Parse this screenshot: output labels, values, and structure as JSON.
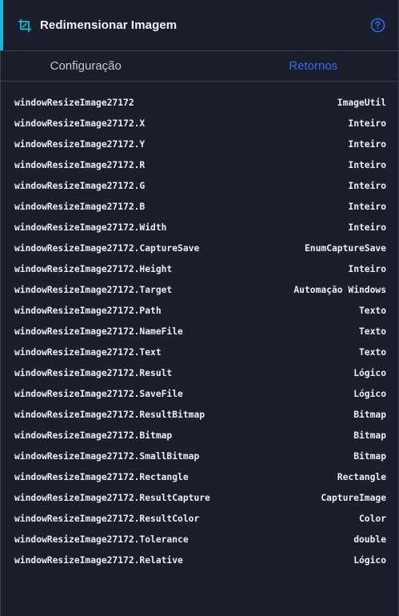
{
  "header": {
    "title": "Redimensionar Imagem",
    "icon": "resize-icon",
    "help_icon": "help-circle-icon",
    "accent_color": "#1ab6d6"
  },
  "tabs": [
    {
      "label": "Configuração",
      "active": false
    },
    {
      "label": "Retornos",
      "active": true,
      "color": "#2f6bf0"
    }
  ],
  "returns": [
    {
      "name": "windowResizeImage27172",
      "type": "ImageUtil"
    },
    {
      "name": "windowResizeImage27172.X",
      "type": "Inteiro"
    },
    {
      "name": "windowResizeImage27172.Y",
      "type": "Inteiro"
    },
    {
      "name": "windowResizeImage27172.R",
      "type": "Inteiro"
    },
    {
      "name": "windowResizeImage27172.G",
      "type": "Inteiro"
    },
    {
      "name": "windowResizeImage27172.B",
      "type": "Inteiro"
    },
    {
      "name": "windowResizeImage27172.Width",
      "type": "Inteiro"
    },
    {
      "name": "windowResizeImage27172.CaptureSave",
      "type": "EnumCaptureSave"
    },
    {
      "name": "windowResizeImage27172.Height",
      "type": "Inteiro"
    },
    {
      "name": "windowResizeImage27172.Target",
      "type": "Automação Windows"
    },
    {
      "name": "windowResizeImage27172.Path",
      "type": "Texto"
    },
    {
      "name": "windowResizeImage27172.NameFile",
      "type": "Texto"
    },
    {
      "name": "windowResizeImage27172.Text",
      "type": "Texto"
    },
    {
      "name": "windowResizeImage27172.Result",
      "type": "Lógico"
    },
    {
      "name": "windowResizeImage27172.SaveFile",
      "type": "Lógico"
    },
    {
      "name": "windowResizeImage27172.ResultBitmap",
      "type": "Bitmap"
    },
    {
      "name": "windowResizeImage27172.Bitmap",
      "type": "Bitmap"
    },
    {
      "name": "windowResizeImage27172.SmallBitmap",
      "type": "Bitmap"
    },
    {
      "name": "windowResizeImage27172.Rectangle",
      "type": "Rectangle"
    },
    {
      "name": "windowResizeImage27172.ResultCapture",
      "type": "CaptureImage"
    },
    {
      "name": "windowResizeImage27172.ResultColor",
      "type": "Color"
    },
    {
      "name": "windowResizeImage27172.Tolerance",
      "type": "double"
    },
    {
      "name": "windowResizeImage27172.Relative",
      "type": "Lógico"
    }
  ]
}
